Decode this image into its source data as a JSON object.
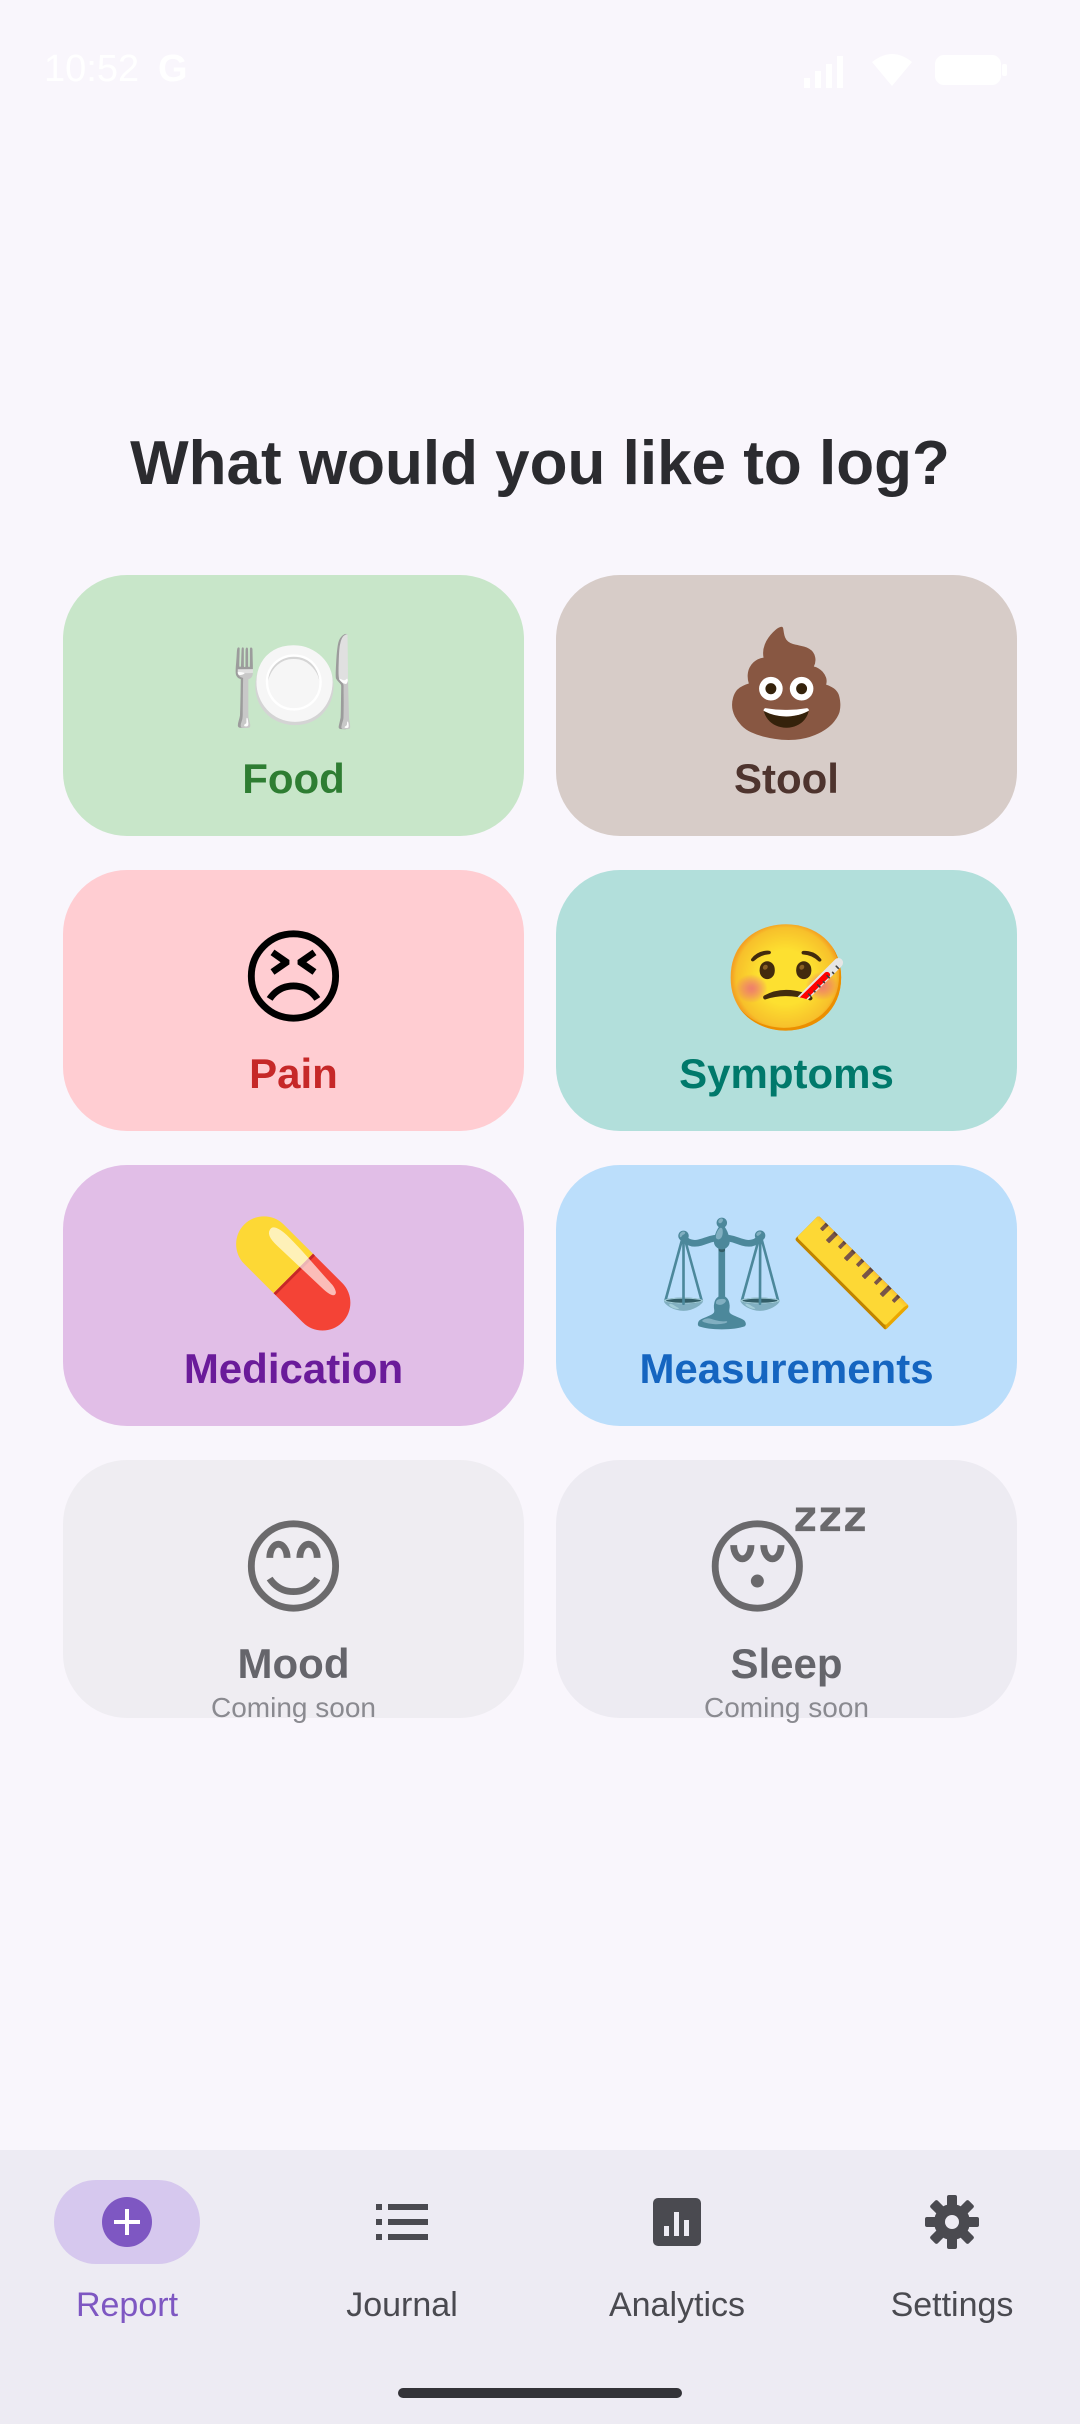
{
  "status_bar": {
    "time": "10:52",
    "g_icon": "G"
  },
  "page": {
    "title": "What would you like to log?"
  },
  "tiles": [
    {
      "id": "food",
      "emoji": "🍽️",
      "label": "Food",
      "subtitle": "",
      "background": "#c8e6c9",
      "text_color": "#2e7d32",
      "enabled": true
    },
    {
      "id": "stool",
      "emoji": "💩",
      "label": "Stool",
      "subtitle": "",
      "background": "#d7ccc8",
      "text_color": "#4e342e",
      "enabled": true
    },
    {
      "id": "pain",
      "emoji": "😣",
      "label": "Pain",
      "subtitle": "",
      "background": "#ffcdd2",
      "text_color": "#c62828",
      "enabled": true
    },
    {
      "id": "symptoms",
      "emoji": "🤒",
      "label": "Symptoms",
      "subtitle": "",
      "background": "#b2dfdb",
      "text_color": "#00796b",
      "enabled": true
    },
    {
      "id": "medication",
      "emoji": "💊",
      "label": "Medication",
      "subtitle": "",
      "background": "#e1bee7",
      "text_color": "#6a1b9a",
      "enabled": true
    },
    {
      "id": "measurements",
      "emoji": "⚖️📏",
      "label": "Measurements",
      "subtitle": "",
      "background": "#bbdefb",
      "text_color": "#1565c0",
      "enabled": true
    },
    {
      "id": "mood",
      "emoji": "😊",
      "label": "Mood",
      "subtitle": "Coming soon",
      "background": "#efedf2",
      "text_color": "#65656b",
      "enabled": false
    },
    {
      "id": "sleep",
      "emoji": "😴",
      "label": "Sleep",
      "subtitle": "Coming soon",
      "background": "#edebf2",
      "text_color": "#65656b",
      "enabled": false
    }
  ],
  "bottom_nav": {
    "items": [
      {
        "label": "Report",
        "icon": "add-circle-icon",
        "active": true
      },
      {
        "label": "Journal",
        "icon": "list-icon",
        "active": false
      },
      {
        "label": "Analytics",
        "icon": "bar-chart-icon",
        "active": false
      },
      {
        "label": "Settings",
        "icon": "gear-icon",
        "active": false
      }
    ],
    "active_color": "#7e57c2",
    "active_pill_color": "#d6c8ee",
    "inactive_color": "#4a4a50"
  }
}
